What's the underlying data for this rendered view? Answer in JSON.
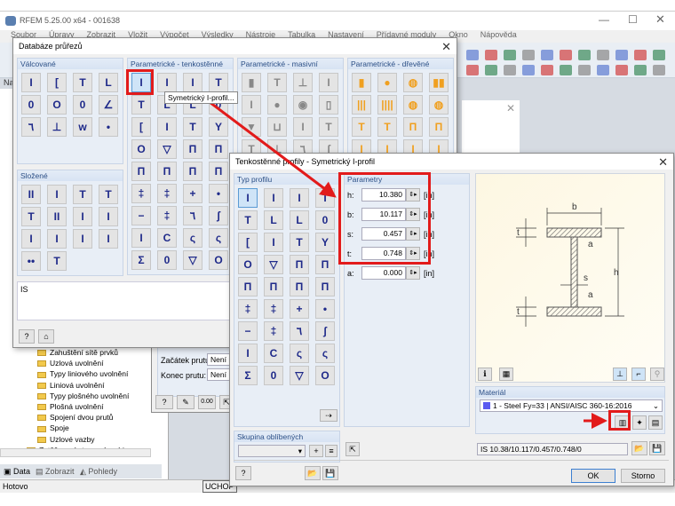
{
  "app": {
    "title": "RFEM 5.25.00 x64 - 001638",
    "menu": [
      "Soubor",
      "Úpravy",
      "Zobrazit",
      "Vložit",
      "Výpočet",
      "Výsledky",
      "Nástroje",
      "Tabulka",
      "Nastavení",
      "Přídavné moduly",
      "Okno",
      "Nápověda"
    ],
    "status": "Hotovo",
    "snap": "UCHOP",
    "nav_label": "Na"
  },
  "db": {
    "title": "Databáze průřezů",
    "groups": {
      "rolled": "Válcované",
      "thin": "Parametrické - tenkostěnné",
      "solid": "Parametrické - masivní",
      "timber": "Parametrické - dřevěné",
      "composite": "Složené"
    },
    "tooltip": "Symetrický I-profil...",
    "selection_text": "IS",
    "rolled_icons": [
      "I",
      "[",
      "T",
      "L",
      "0",
      "O",
      "0",
      "∠",
      "٦",
      "⊥",
      "w",
      "•"
    ],
    "thin_icons": [
      "I",
      "I",
      "I",
      "T",
      "T",
      "L",
      "L",
      "0",
      "[",
      "I",
      "T",
      "Y",
      "O",
      "▽",
      "Π",
      "Π",
      "Π",
      "Π",
      "Π",
      "Π",
      "‡",
      "‡",
      "+",
      "•",
      "−",
      "‡",
      "٦",
      "ʃ",
      "I",
      "C",
      "ς",
      "ς",
      "Σ",
      "0",
      "▽",
      "O"
    ],
    "solid_icons": [
      "▮",
      "T",
      "⊥",
      "I",
      "I",
      "●",
      "◉",
      "▯",
      "▼",
      "⊔",
      "I",
      "T",
      "T",
      "⊥",
      "٦",
      "ʃ"
    ],
    "timber_icons": [
      "▮",
      "●",
      "◍",
      "▮▮",
      "|||",
      "||||",
      "◍",
      "◍",
      "T",
      "T",
      "Π",
      "Π",
      "I",
      "I",
      "I",
      "I"
    ],
    "composite_icons": [
      "II",
      "I",
      "T",
      "T",
      "T",
      "II",
      "I",
      "I",
      "I",
      "I",
      "I",
      "I",
      "••",
      "T"
    ]
  },
  "tree": {
    "items": [
      "Zahuštění sítě prvků",
      "Uzlová uvolnění",
      "Typy liniového uvolnění",
      "Liniová uvolnění",
      "Typy plošného uvolnění",
      "Plošná uvolnění",
      "Spojení dvou prutů",
      "Spoje",
      "Uzlové vazby",
      "Zatěžovací stavy a kombinace"
    ],
    "tabs": [
      "Data",
      "Zobrazit",
      "Pohledy"
    ]
  },
  "member": {
    "start_label": "Začátek prutu:",
    "start_value": "Není",
    "end_label": "Konec prutu:",
    "end_value": "Není"
  },
  "profile": {
    "title": "Tenkostěnné profily - Symetrický I-profil",
    "type_label": "Typ profilu",
    "type_icons": [
      "I",
      "I",
      "I",
      "T",
      "T",
      "L",
      "L",
      "0",
      "[",
      "I",
      "T",
      "Y",
      "O",
      "▽",
      "Π",
      "Π",
      "Π",
      "Π",
      "Π",
      "Π",
      "‡",
      "‡",
      "+",
      "•",
      "−",
      "‡",
      "٦",
      "ʃ",
      "I",
      "C",
      "ς",
      "ς",
      "Σ",
      "0",
      "▽",
      "O"
    ],
    "params_label": "Parametry",
    "params": [
      {
        "name": "h:",
        "value": "10.380",
        "unit": "[in]"
      },
      {
        "name": "b:",
        "value": "10.117",
        "unit": "[in]"
      },
      {
        "name": "s:",
        "value": "0.457",
        "unit": "[in]"
      },
      {
        "name": "t:",
        "value": "0.748",
        "unit": "[in]"
      },
      {
        "name": "a:",
        "value": "0.000",
        "unit": "[in]"
      }
    ],
    "favorites_label": "Skupina oblíbených",
    "material_label": "Materiál",
    "material_value": "1 - Steel Fy=33 | ANSI/AISC 360-16:2016",
    "material_color": "#5b5bf0",
    "section_string": "IS 10.38/10.117/0.457/0.748/0",
    "ok": "OK",
    "cancel": "Storno",
    "dims": {
      "b": "b",
      "h": "h",
      "s": "s",
      "t": "t",
      "a": "a"
    }
  },
  "colors": {
    "highlight": "#e21b1b",
    "icon": "#1f2a8a",
    "timber": "#f0a020"
  }
}
